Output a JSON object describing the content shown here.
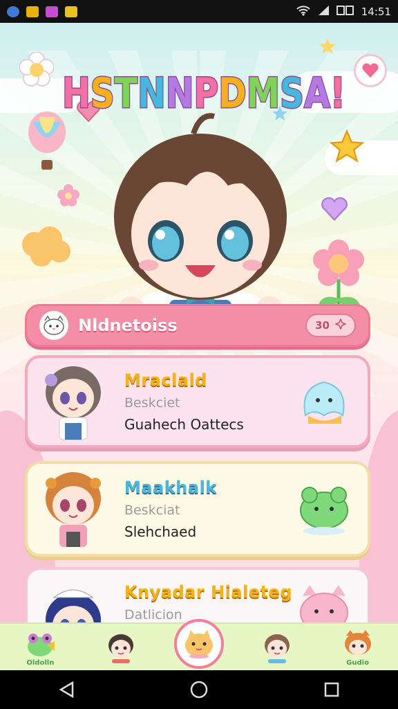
{
  "status_bar": {
    "time": "14:51",
    "left_icons": [
      "location-icon",
      "message-icon",
      "bag-icon",
      "pen-icon"
    ],
    "right_icons": [
      "wifi-icon",
      "signal-icon",
      "sim-icon"
    ]
  },
  "header": {
    "title": "HSTNNPDMSA!",
    "title_colors": [
      "#f36fa4",
      "#f6b01c",
      "#7fd35b",
      "#46b8de",
      "#b579e6"
    ]
  },
  "search": {
    "label": "Nldnetoiss",
    "pill_value": "30"
  },
  "cards": [
    {
      "name": "Mraclald",
      "sub": "Beskciet",
      "desc": "Guahech Oattecs"
    },
    {
      "name": "Maakhalk",
      "sub": "Beskciat",
      "desc": "Slehchaed"
    },
    {
      "name": "Knyadar Hialeteg",
      "sub": "Datlicion",
      "desc": ""
    }
  ],
  "bottom_nav": [
    {
      "label": "Oldolln",
      "icon": "frog-icon"
    },
    {
      "label": "",
      "icon": "boy-icon"
    },
    {
      "label": "",
      "icon": "cat-face-icon"
    },
    {
      "label": "",
      "icon": "girl-icon"
    },
    {
      "label": "Gudio",
      "icon": "fox-icon"
    }
  ],
  "colors": {
    "accent_pink": "#f48ea7",
    "card_yellow_text": "#f5b21a",
    "card_blue_text": "#4cb7d8",
    "nav_bg": "#e6f6c4"
  }
}
